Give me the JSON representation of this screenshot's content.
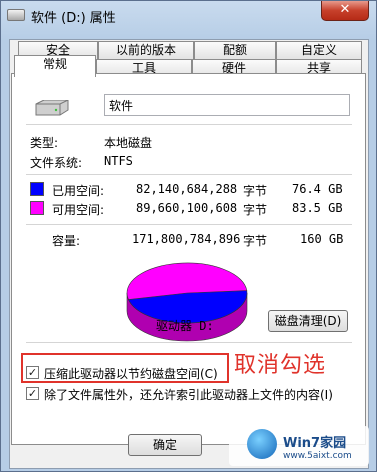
{
  "window": {
    "title": "软件 (D:) 属性",
    "close_glyph": "✕"
  },
  "tabs_row1": [
    "安全",
    "以前的版本",
    "配额",
    "自定义"
  ],
  "tabs_row2": [
    "常规",
    "工具",
    "硬件",
    "共享"
  ],
  "general": {
    "drive_name": "软件",
    "type_label": "类型:",
    "type_value": "本地磁盘",
    "fs_label": "文件系统:",
    "fs_value": "NTFS",
    "used_label": "已用空间:",
    "used_bytes": "82,140,684,288",
    "used_unit": "字节",
    "used_size": "76.4 GB",
    "free_label": "可用空间:",
    "free_bytes": "89,660,100,608",
    "free_unit": "字节",
    "free_size": "83.5 GB",
    "cap_label": "容量:",
    "cap_bytes": "171,800,784,896",
    "cap_unit": "字节",
    "cap_size": "160 GB",
    "drive_label": "驱动器 D:",
    "cleanup_button": "磁盘清理(D)",
    "compress_label": "压缩此驱动器以节约磁盘空间(C)",
    "index_label": "除了文件属性外，还允许索引此驱动器上文件的内容(I)",
    "compress_checked": true,
    "index_checked": true
  },
  "annotation": "取消勾选",
  "buttons": {
    "ok": "确定"
  },
  "watermark": {
    "title": "Win7家园",
    "url": "www.5aixt.com"
  },
  "colors": {
    "used": "#0000ff",
    "free": "#ff00ff",
    "highlight": "#e0332b"
  },
  "chart_data": {
    "type": "pie",
    "categories": [
      "已用空间",
      "可用空间"
    ],
    "values": [
      76.4,
      83.5
    ]
  }
}
